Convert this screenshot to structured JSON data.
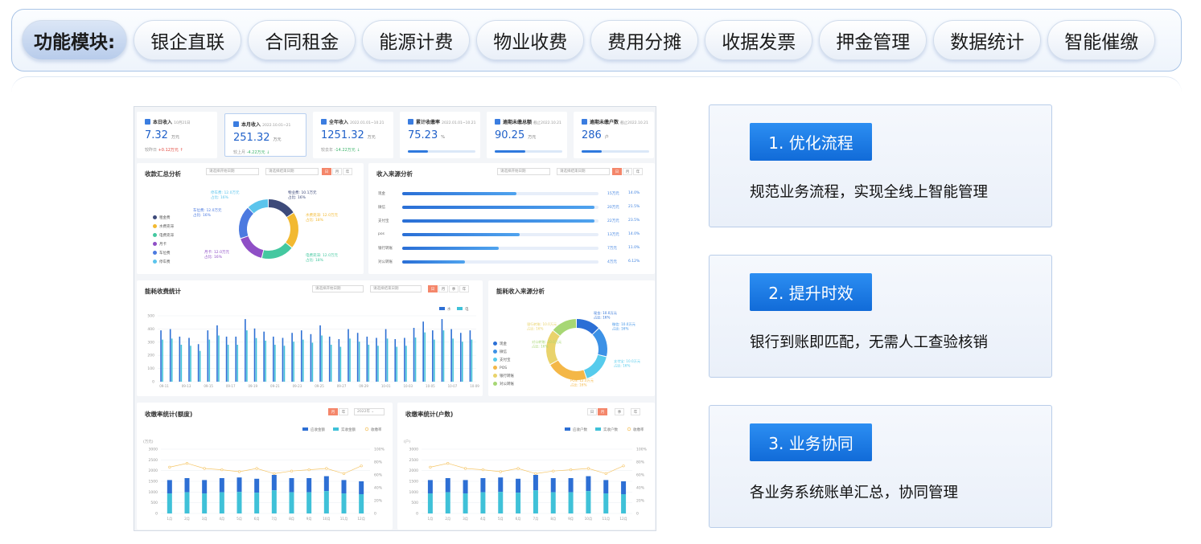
{
  "nav": {
    "label": "功能模块:",
    "items": [
      "银企直联",
      "合同租金",
      "能源计费",
      "物业收费",
      "费用分摊",
      "收据发票",
      "押金管理",
      "数据统计",
      "智能催缴"
    ]
  },
  "dashboard": {
    "stats": [
      {
        "label": "本日收入",
        "date": "10月21日",
        "value": "7.32",
        "unit": "万元",
        "cmp_label": "较昨日",
        "cmp": "+0.12万元",
        "trend": "up",
        "progress": null
      },
      {
        "label": "本月收入",
        "date": "2022.10.01~21",
        "value": "251.32",
        "unit": "万元",
        "cmp_label": "较上月",
        "cmp": "-4.22万元",
        "trend": "down",
        "progress": null
      },
      {
        "label": "全年收入",
        "date": "2022.01.01~10.21",
        "value": "1251.32",
        "unit": "万元",
        "cmp_label": "较去年",
        "cmp": "-14.22万元",
        "trend": "down",
        "progress": null
      },
      {
        "label": "累计收缴率",
        "date": "2022.01.01~10.21",
        "value": "75.23",
        "unit": "%",
        "cmp_label": "",
        "cmp": "",
        "trend": "",
        "progress": 0.3
      },
      {
        "label": "逾期未缴总额",
        "date": "截止2022.10.21",
        "value": "90.25",
        "unit": "万元",
        "cmp_label": "",
        "cmp": "",
        "trend": "",
        "progress": 0.45
      },
      {
        "label": "逾期未缴户数",
        "date": "截止2022.10.21",
        "value": "286",
        "unit": "户",
        "cmp_label": "",
        "cmp": "",
        "trend": "",
        "progress": 0.3
      }
    ],
    "collection": {
      "title": "收款汇总分析",
      "start_ph": "请选择开始日期",
      "end_ph": "请选择结束日期",
      "segs": [
        "日",
        "月",
        "年"
      ],
      "legend": [
        "租金费",
        "水费売滞",
        "电费売滞",
        "月卡",
        "车位费",
        "停车费"
      ],
      "colors": [
        "#3d4a7a",
        "#f2b931",
        "#44c8a0",
        "#8f4fc6",
        "#4c7ae0",
        "#5bc4ec"
      ],
      "values": [
        16,
        20,
        18,
        16,
        18,
        12
      ],
      "callouts": [
        {
          "name": "物业费:",
          "val": "10.1万元",
          "pct": "占比: 16%"
        },
        {
          "name": "水费売滞:",
          "val": "12.0万元",
          "pct": "占比: 18%"
        },
        {
          "name": "电费売滞:",
          "val": "12.0万元",
          "pct": "占比: 18%"
        },
        {
          "name": "月卡:",
          "val": "12.0万元",
          "pct": "占比: 16%"
        },
        {
          "name": "车位费:",
          "val": "12.0万元",
          "pct": "占比: 16%"
        },
        {
          "name": "停车费:",
          "val": "12.0万元",
          "pct": "占比: 16%"
        }
      ]
    },
    "source": {
      "title": "收入来源分析",
      "start_ph": "请选择开始日期",
      "end_ph": "请选择结束日期",
      "segs": [
        "日",
        "月",
        "年"
      ],
      "rows": [
        {
          "label": "现金",
          "amount": "15万元",
          "pct": "14.0%",
          "fill": 0.58
        },
        {
          "label": "微信",
          "amount": "20万元",
          "pct": "21.5%",
          "fill": 0.98
        },
        {
          "label": "支付宝",
          "amount": "22万元",
          "pct": "23.5%",
          "fill": 0.98
        },
        {
          "label": "pos",
          "amount": "13万元",
          "pct": "14.0%",
          "fill": 0.6
        },
        {
          "label": "银行转账",
          "amount": "7万元",
          "pct": "11.0%",
          "fill": 0.49
        },
        {
          "label": "对公转账",
          "amount": "4万元",
          "pct": "6.12%",
          "fill": 0.32
        }
      ]
    },
    "energy": {
      "title": "能耗收费统计",
      "start_ph": "请选择开始日期",
      "end_ph": "请选择结束日期",
      "segs": [
        "日",
        "月",
        "季",
        "年"
      ],
      "legend": [
        "水",
        "电"
      ],
      "yticks": [
        "500",
        "400",
        "300",
        "200",
        "100",
        "0"
      ],
      "xticks": [
        "09-11",
        "09-13",
        "09-15",
        "09-17",
        "09-19",
        "09-21",
        "09-23",
        "09-25",
        "09-27",
        "09-29",
        "10-01",
        "10-03",
        "10-05",
        "10-07",
        "10-09"
      ]
    },
    "energy_source": {
      "title": "能耗收入来源分析",
      "legend": [
        "现金",
        "微信",
        "支付宝",
        "POS",
        "银行转账",
        "对公转账"
      ],
      "colors": [
        "#2b6fd6",
        "#3c91e6",
        "#56cbec",
        "#f4b747",
        "#e9d36b",
        "#a7d774"
      ],
      "values": [
        13,
        16,
        16,
        22,
        19,
        14
      ],
      "callouts": [
        {
          "name": "现金:",
          "val": "10.0万元",
          "pct": "占比: 16%"
        },
        {
          "name": "微信:",
          "val": "10.0万元",
          "pct": "占比: 16%"
        },
        {
          "name": "支付宝:",
          "val": "10.0万元",
          "pct": "占比: 16%"
        },
        {
          "name": "POS:",
          "val": "12.0万元",
          "pct": "占比: 16%"
        },
        {
          "name": "银行转账:",
          "val": "10.0万元",
          "pct": "占比: 16%"
        },
        {
          "name": "对公转账:",
          "val": "10.0万元",
          "pct": "占比: 16%"
        }
      ]
    },
    "rate_amount": {
      "title": "收缴率统计(额度)",
      "segs": [
        "月",
        "年"
      ],
      "year": "2022年",
      "legend": [
        "应收金额",
        "实收金额",
        "收缴率"
      ],
      "unit": "(万元)",
      "yticks": [
        "3000",
        "2500",
        "2000",
        "1500",
        "1000",
        "500",
        "0"
      ],
      "rticks": [
        "100%",
        "80%",
        "60%",
        "40%",
        "20%",
        "0"
      ],
      "months": [
        "1月",
        "2月",
        "3月",
        "4月",
        "5月",
        "6月",
        "7月",
        "8月",
        "9月",
        "10月",
        "11月",
        "12月"
      ]
    },
    "rate_count": {
      "title": "收缴率统计(户数)",
      "segs": [
        "日",
        "月",
        "季",
        "年"
      ],
      "legend": [
        "应收户数",
        "实收户数",
        "收缴率"
      ],
      "unit": "(户)",
      "yticks": [
        "3000",
        "2500",
        "2000",
        "1500",
        "1000",
        "500",
        "0"
      ],
      "rticks": [
        "100%",
        "80%",
        "60%",
        "40%",
        "20%",
        "0"
      ],
      "months": [
        "1月",
        "2月",
        "3月",
        "4月",
        "5月",
        "6月",
        "7月",
        "8月",
        "9月",
        "10月",
        "11月",
        "12月"
      ]
    }
  },
  "features": [
    {
      "title": "1. 优化流程",
      "desc": "规范业务流程，实现全线上智能管理"
    },
    {
      "title": "2. 提升时效",
      "desc": "银行到账即匹配，无需人工查验核销"
    },
    {
      "title": "3. 业务协同",
      "desc": "各业务系统账单汇总，协同管理"
    }
  ]
}
